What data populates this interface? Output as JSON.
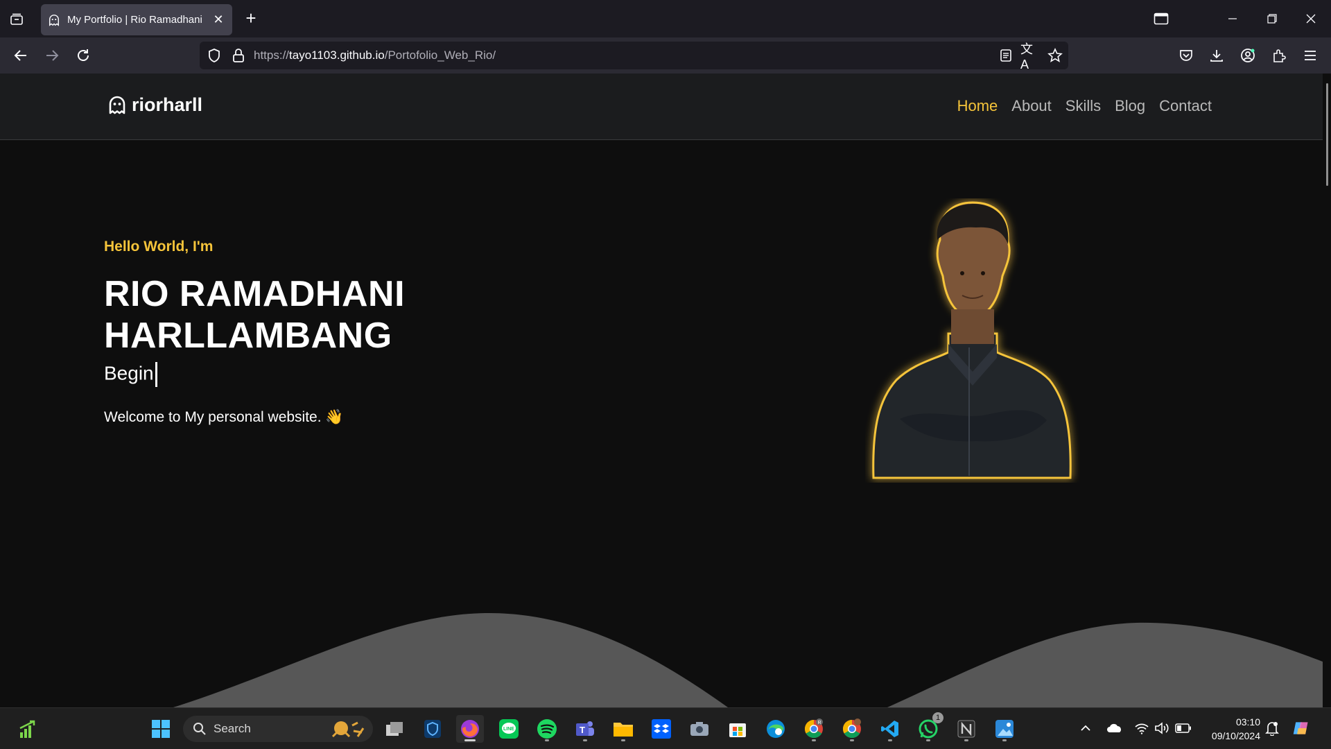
{
  "browser": {
    "tab_title": "My Portfolio | Rio Ramadhani H",
    "url_prefix": "https://",
    "url_host": "tayo1103.github.io",
    "url_path": "/Portofolio_Web_Rio/"
  },
  "site": {
    "logo_text": "riorharll",
    "nav": [
      {
        "label": "Home",
        "active": true
      },
      {
        "label": "About",
        "active": false
      },
      {
        "label": "Skills",
        "active": false
      },
      {
        "label": "Blog",
        "active": false
      },
      {
        "label": "Contact",
        "active": false
      }
    ],
    "greeting": "Hello World, I'm",
    "name_line1": "RIO RAMADHANI",
    "name_line2": "HARLLAMBANG",
    "typed_text": "Begin",
    "welcome": "Welcome to My personal website. 👋"
  },
  "taskbar": {
    "search_placeholder": "Search",
    "time": "03:10",
    "date": "09/10/2024",
    "whatsapp_badge": "1"
  },
  "colors": {
    "accent": "#f5c43a",
    "page_bg": "#0e0e0e",
    "header_bg": "#1b1c1e",
    "wave": "#575757"
  }
}
